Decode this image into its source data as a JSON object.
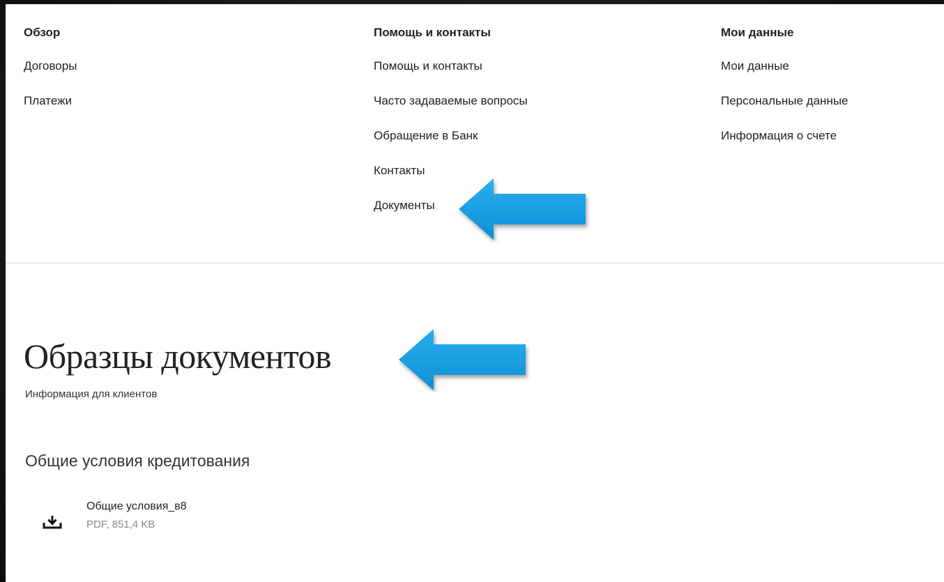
{
  "nav": {
    "columns": [
      {
        "heading": "Обзор",
        "links": [
          "Договоры",
          "Платежи"
        ]
      },
      {
        "heading": "Помощь и контакты",
        "links": [
          "Помощь и контакты",
          "Часто задаваемые вопросы",
          "Обращение в Банк",
          "Контакты",
          "Документы"
        ]
      },
      {
        "heading": "Мои данные",
        "links": [
          "Мои данные",
          "Персональные данные",
          "Информация о счете"
        ]
      }
    ]
  },
  "page": {
    "title": "Образцы документов",
    "subtitle": "Информация для клиентов"
  },
  "section": {
    "heading": "Общие условия кредитования",
    "documents": [
      {
        "name": "Общие условия_в8",
        "meta": "PDF, 851,4 KB",
        "icon": "download-icon"
      }
    ]
  },
  "annotations": {
    "arrow_color": "#1a9ee0",
    "arrows": [
      "arrow-icon",
      "arrow-icon"
    ]
  }
}
